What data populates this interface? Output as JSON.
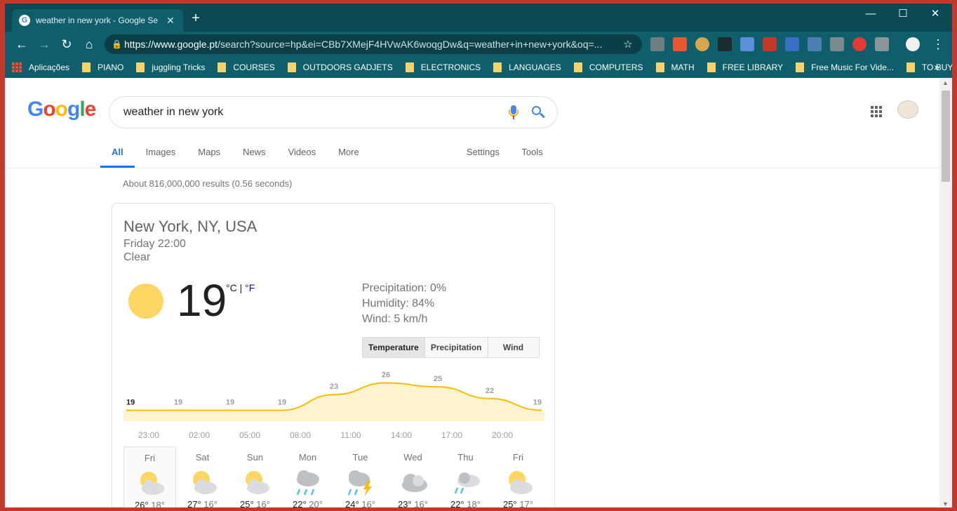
{
  "browser": {
    "tab_title": "weather in new york - Google Se",
    "url_host": "https://www.google.pt",
    "url_path": "/search?source=hp&ei=CBb7XMejF4HVwAK6woqgDw&q=weather+in+new+york&oq=...",
    "bookmarks": [
      "Aplicações",
      "PIANO",
      "juggling Tricks",
      "COURSES",
      "OUTDOORS GADJETS",
      "ELECTRONICS",
      "LANGUAGES",
      "COMPUTERS",
      "MATH",
      "FREE LIBRARY",
      "Free Music For Vide...",
      "TO BUY"
    ]
  },
  "search": {
    "query": "weather in new york",
    "tabs": [
      "All",
      "Images",
      "Maps",
      "News",
      "Videos",
      "More"
    ],
    "tabs_right": [
      "Settings",
      "Tools"
    ],
    "stats": "About 816,000,000 results (0.56 seconds)"
  },
  "weather": {
    "location": "New York, NY, USA",
    "time": "Friday 22:00",
    "condition": "Clear",
    "temperature": "19",
    "unit_c": "°C",
    "unit_sep": " | ",
    "unit_f": "°F",
    "precipitation": "Precipitation: 0%",
    "humidity": "Humidity: 84%",
    "wind": "Wind: 5 km/h",
    "segments": [
      "Temperature",
      "Precipitation",
      "Wind"
    ]
  },
  "chart_data": {
    "type": "area",
    "x": [
      "23:00",
      "02:00",
      "05:00",
      "08:00",
      "11:00",
      "14:00",
      "17:00",
      "20:00"
    ],
    "labels": [
      "19",
      "19",
      "19",
      "19",
      "23",
      "26",
      "25",
      "22",
      "19"
    ],
    "values": [
      19,
      19,
      19,
      19,
      23,
      26,
      25,
      22,
      19
    ],
    "color": "#fbbc04",
    "fill": "#fdf3cf"
  },
  "forecast": [
    {
      "day": "Fri",
      "hi": "26°",
      "lo": "18°",
      "icon": "partly-sunny-icon"
    },
    {
      "day": "Sat",
      "hi": "27°",
      "lo": "16°",
      "icon": "partly-sunny-icon"
    },
    {
      "day": "Sun",
      "hi": "25°",
      "lo": "16°",
      "icon": "partly-sunny-icon"
    },
    {
      "day": "Mon",
      "hi": "22°",
      "lo": "20°",
      "icon": "rain-icon"
    },
    {
      "day": "Tue",
      "hi": "24°",
      "lo": "16°",
      "icon": "thunderstorm-icon"
    },
    {
      "day": "Wed",
      "hi": "23°",
      "lo": "16°",
      "icon": "cloudy-icon"
    },
    {
      "day": "Thu",
      "hi": "22°",
      "lo": "18°",
      "icon": "showers-icon"
    },
    {
      "day": "Fri",
      "hi": "25°",
      "lo": "17°",
      "icon": "partly-sunny-icon"
    }
  ]
}
